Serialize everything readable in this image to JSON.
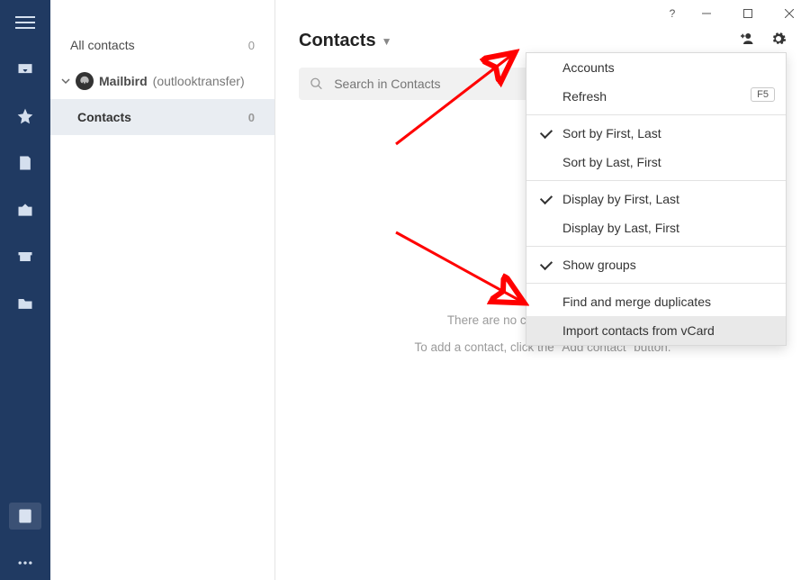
{
  "window": {
    "help_glyph": "?"
  },
  "rail": {
    "items": [
      {
        "name": "hamburger-icon"
      },
      {
        "name": "inbox-icon"
      },
      {
        "name": "star-icon"
      },
      {
        "name": "note-icon"
      },
      {
        "name": "outbox-icon"
      },
      {
        "name": "archive-icon"
      },
      {
        "name": "folder-icon"
      }
    ],
    "contacts_icon": "contacts-icon",
    "more_icon": "more-icon"
  },
  "sidebar": {
    "all_label": "All contacts",
    "all_count": "0",
    "account": {
      "name": "Mailbird",
      "alias": "(outlooktransfer)"
    },
    "folder": {
      "label": "Contacts",
      "count": "0"
    }
  },
  "header": {
    "title": "Contacts"
  },
  "search": {
    "placeholder": "Search in Contacts"
  },
  "empty": {
    "line1": "There are no contacts in this group.",
    "line2": "To add a contact, click the \"Add contact\" button."
  },
  "menu": {
    "accounts": "Accounts",
    "refresh": "Refresh",
    "refresh_key": "F5",
    "sort_first": "Sort by First, Last",
    "sort_last": "Sort by Last, First",
    "display_first": "Display by First, Last",
    "display_last": "Display by Last, First",
    "show_groups": "Show groups",
    "find_dup": "Find and merge duplicates",
    "import_vcard": "Import contacts from vCard"
  }
}
